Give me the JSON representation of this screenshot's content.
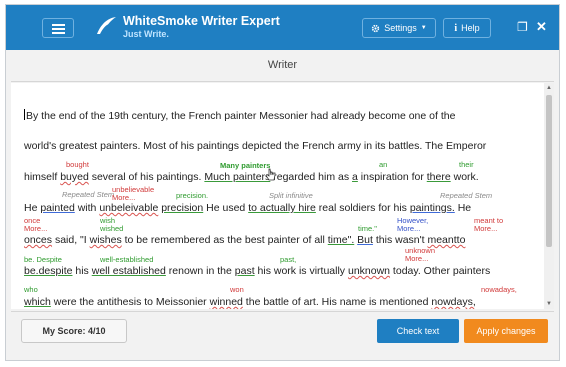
{
  "app": {
    "name": "WhiteSmoke Writer Expert",
    "slogan": "Just Write.",
    "settings_label": "Settings",
    "help_label": "Help",
    "restore_glyph": "❐",
    "close_glyph": "✕",
    "document_title": "Writer"
  },
  "text": {
    "line1": "y the end of the 19th century, the French painter Messonier had already become one of the",
    "line2": "world's greatest painters. Most of his paintings depicted the French army in its battles. The Emperor",
    "line3": {
      "a": "himself ",
      "b": "buyed",
      "c": " several of his paintings. ",
      "d": "Much painters",
      "e": " regarded him as ",
      "f": "a",
      "g": " inspiration for ",
      "h": "there",
      "i": " work."
    },
    "line4": {
      "a": "He ",
      "b": "painted",
      "c": " with ",
      "d": "unbeleivable",
      "e": " ",
      "f": "precision",
      "g": " He used ",
      "h": "to actually hire",
      "i": " real soldiers for his ",
      "j": "paintings.",
      "k": " He"
    },
    "line5": {
      "a": "onces",
      "b": " said, \"I ",
      "c": "wishes",
      "d": " to be remembered as the best painter of all ",
      "e": "time\".",
      "f": " ",
      "g": "But",
      "h": " this wasn't ",
      "i": "meantto"
    },
    "line6": {
      "a": "be.despite",
      "b": " his ",
      "c": "well established",
      "d": " renown in the ",
      "e": "past",
      "f": " his work is virtually ",
      "g": "unknown",
      "h": " today. Other painters"
    },
    "line7": {
      "a": "which",
      "b": " were the antithesis to Meissonier ",
      "c": "winned",
      "d": " the battle of art. His name is mentioned ",
      "e": "nowdays,"
    }
  },
  "suggestions": {
    "bought": "bought",
    "many_painters": "Many painters",
    "an": "an",
    "their": "their",
    "repeated_stem_1": "Repeated Stem",
    "unbelievable": "unbelievable",
    "more_1": "More...",
    "precision": "precision.",
    "split_infinitive": "Split infinitive",
    "repeated_stem_2": "Repeated Stem",
    "once": "once",
    "more_2": "More...",
    "wish": "wish",
    "wished": "wished",
    "time": "time.\"",
    "however": "However,",
    "more_3": "More...",
    "meant_to": "meant to",
    "more_4": "More...",
    "unknown": "unknown",
    "more_5": "More...",
    "be_despite": "be. Despite",
    "well_established": "well-established",
    "past": "past,",
    "who": "who",
    "won": "won",
    "nowadays": "nowadays,"
  },
  "footer": {
    "score_label": "My Score: 4/10",
    "check_label": "Check text",
    "apply_label": "Apply changes"
  },
  "colors": {
    "titlebar": "#1f7fc2",
    "check_button": "#1f7fc2",
    "apply_button": "#f18a1e",
    "error_red": "#d13a3a",
    "suggestion_green": "#2f9b2f",
    "suggestion_blue": "#3552c8"
  }
}
